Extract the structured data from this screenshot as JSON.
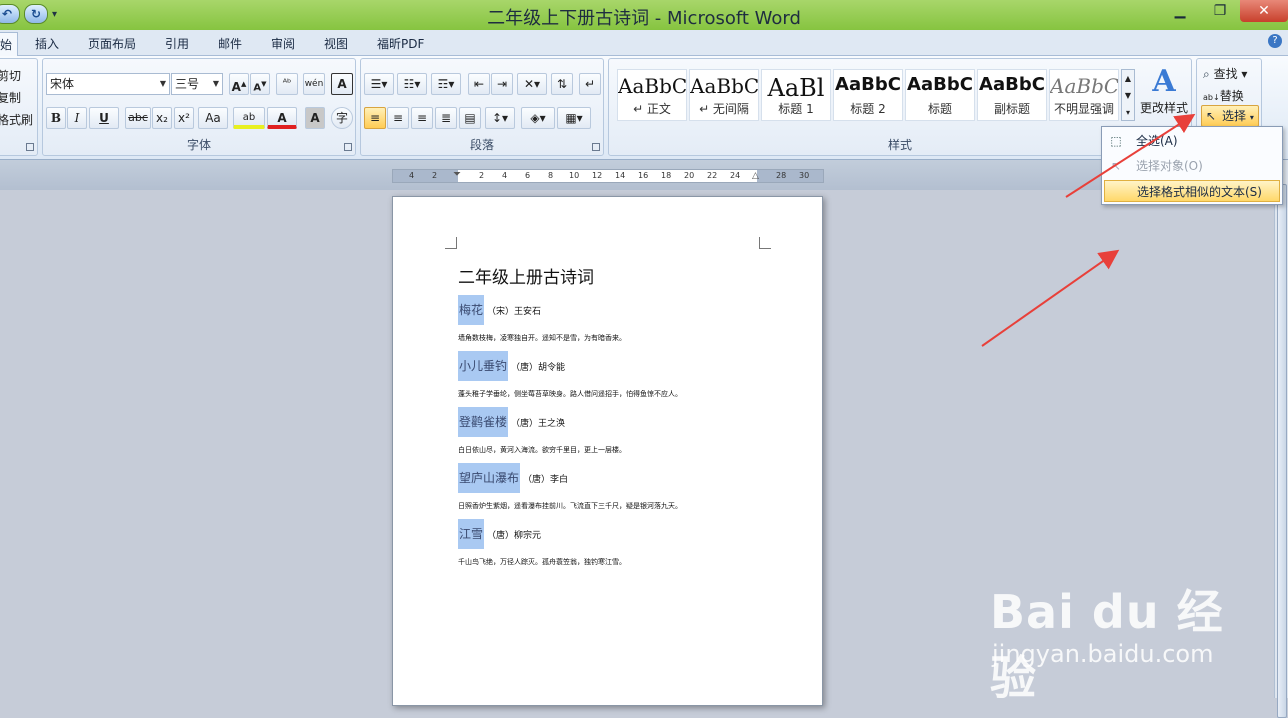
{
  "window": {
    "title": "二年级上下册古诗词 - Microsoft Word"
  },
  "qat": {
    "undo_icon": "undo-icon",
    "redo_icon": "redo-icon",
    "more": "▾"
  },
  "tabs": [
    {
      "label": "始",
      "active": true
    },
    {
      "label": "插入"
    },
    {
      "label": "页面布局"
    },
    {
      "label": "引用"
    },
    {
      "label": "邮件"
    },
    {
      "label": "审阅"
    },
    {
      "label": "视图"
    },
    {
      "label": "福昕PDF"
    }
  ],
  "clipboard": {
    "cut": "剪切",
    "copy": "复制",
    "format_painter": "格式刷"
  },
  "font": {
    "name": "宋体",
    "size": "三号",
    "group_label": "字体",
    "buttons": [
      "B",
      "I",
      "U",
      "abc",
      "x₂",
      "x²",
      "Aa"
    ]
  },
  "paragraph": {
    "group_label": "段落"
  },
  "styles": {
    "group_label": "样式",
    "tiles": [
      {
        "sample": "AaBbC",
        "name": "↵ 正文"
      },
      {
        "sample": "AaBbC",
        "name": "↵ 无间隔"
      },
      {
        "sample": "AaBl",
        "name": "标题 1"
      },
      {
        "sample": "AaBbC",
        "name": "标题 2"
      },
      {
        "sample": "AaBbC",
        "name": "标题"
      },
      {
        "sample": "AaBbC",
        "name": "副标题"
      },
      {
        "sample": "AaBbC",
        "name": "不明显强调"
      }
    ],
    "change_styles": "更改样式"
  },
  "editing": {
    "find": "查找",
    "replace": "替换",
    "select": "选择"
  },
  "select_menu": [
    {
      "label": "全选(A)",
      "state": "normal"
    },
    {
      "label": "选择对象(O)",
      "state": "disabled"
    },
    {
      "label": "选择格式相似的文本(S)",
      "state": "hover"
    }
  ],
  "ruler": {
    "ticks": [
      "4",
      "2",
      "2",
      "4",
      "6",
      "8",
      "10",
      "12",
      "14",
      "16",
      "18",
      "20",
      "22",
      "24",
      "28",
      "30"
    ]
  },
  "document": {
    "title": "二年级上册古诗词",
    "poems": [
      {
        "title": "梅花",
        "author": "（宋）王安石",
        "body": "墙角数枝梅，凌寒独自开。遥知不是雪，为有暗香来。"
      },
      {
        "title": "小儿垂钓",
        "author": "（唐）胡令能",
        "body": "蓬头稚子学垂纶，侧坐莓苔草映身。路人借问遥招手，怕得鱼惊不应人。"
      },
      {
        "title": "登鹳雀楼",
        "author": "（唐）王之涣",
        "body": "白日依山尽，黄河入海流。欲穷千里目，更上一层楼。"
      },
      {
        "title": "望庐山瀑布",
        "author": "（唐）李白",
        "body": "日照香炉生紫烟，遥看瀑布挂前川。飞流直下三千尺，疑是银河落九天。"
      },
      {
        "title": "江雪",
        "author": "（唐）柳宗元",
        "body": "千山鸟飞绝，万径人踪灭。孤舟蓑笠翁，独钓寒江雪。"
      }
    ]
  },
  "watermark": {
    "brand": "Bai du 经验",
    "url": "jingyan.baidu.com"
  },
  "colors": {
    "title_bar": "#86c440",
    "highlight": "#a9c9f2",
    "arrow": "#e8403a",
    "hover_item": "#ffd86a"
  }
}
